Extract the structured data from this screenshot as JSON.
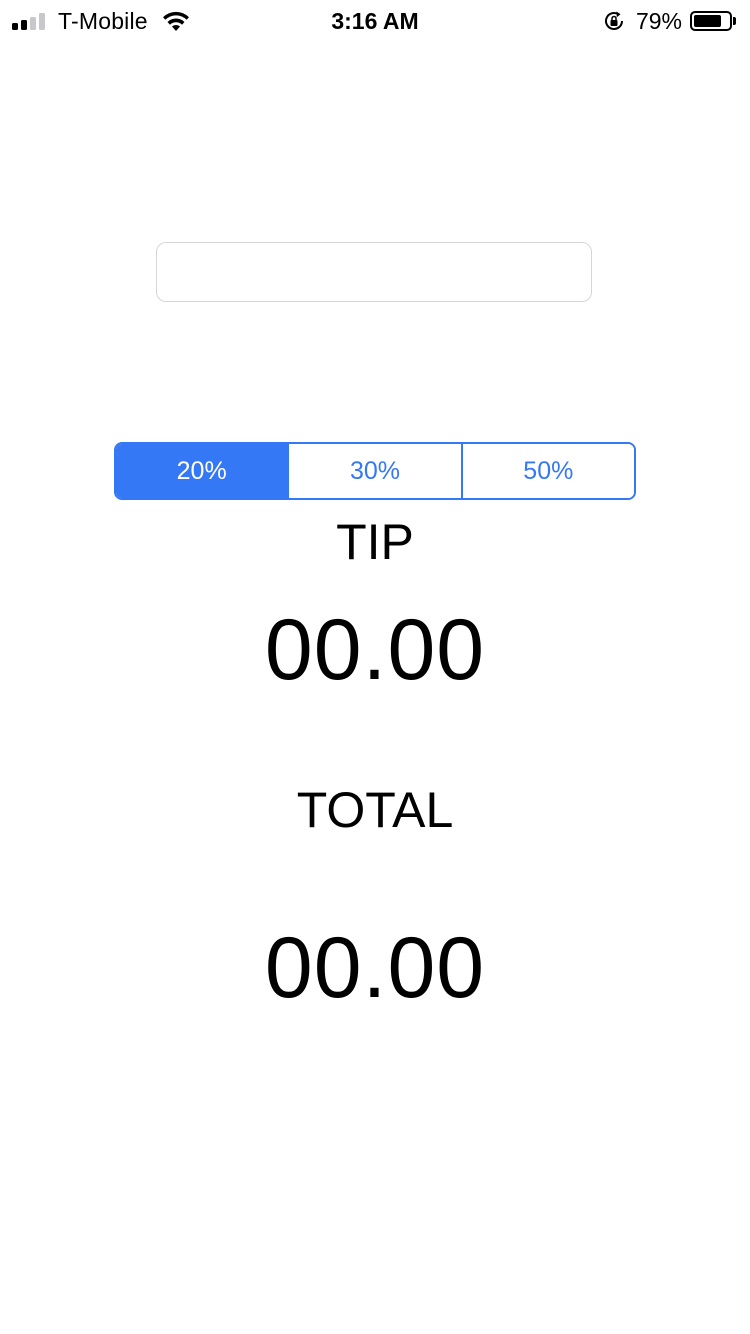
{
  "status_bar": {
    "carrier": "T-Mobile",
    "time": "3:16 AM",
    "battery_percent": "79%",
    "battery_level": 0.79,
    "signal_bars_filled": 2,
    "signal_bars_total": 4
  },
  "bill": {
    "value": "",
    "placeholder": ""
  },
  "tip_options": {
    "options": [
      "20%",
      "30%",
      "50%"
    ],
    "selected_index": 0
  },
  "tip": {
    "label": "TIP",
    "value": "00.00"
  },
  "total": {
    "label": "TOTAL",
    "value": "00.00"
  },
  "colors": {
    "accent": "#3478f6",
    "text": "#000000",
    "background": "#ffffff",
    "input_border": "#d6d6d6"
  },
  "icons": {
    "signal": "cellular-signal-icon",
    "wifi": "wifi-icon",
    "rotation_lock": "rotation-lock-icon",
    "battery": "battery-icon"
  }
}
